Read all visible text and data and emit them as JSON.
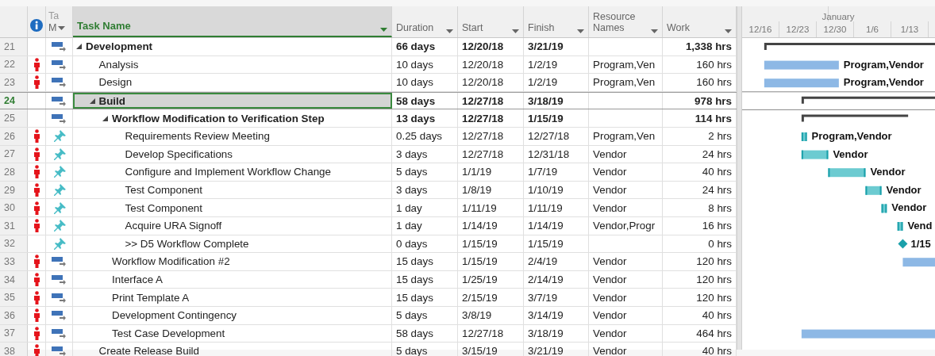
{
  "table": {
    "mode_header": [
      "Ta",
      "M"
    ],
    "columns": [
      {
        "label": "Task Name",
        "selected": true
      },
      {
        "label": "Duration",
        "selected": false
      },
      {
        "label": "Start",
        "selected": false
      },
      {
        "label": "Finish",
        "selected": false
      },
      {
        "label": "Resource Names",
        "selected": false
      },
      {
        "label": "Work",
        "selected": false
      }
    ],
    "tasks": [
      {
        "id": "21",
        "name": "Development",
        "kind": "summary",
        "manually_scheduled": false,
        "resource_alert": false,
        "selected": false,
        "duration": "66 days",
        "start": "12/20/18",
        "finish": "3/21/19",
        "work": "1,338 hrs",
        "children": [
          {
            "id": "22",
            "name": "Analysis",
            "kind": "task",
            "manually_scheduled": false,
            "resource_alert": true,
            "selected": false,
            "duration": "10 days",
            "start": "12/20/18",
            "finish": "1/2/19",
            "resources": "Program,Ven",
            "work": "160 hrs",
            "bar_label": "Program,Vendor"
          },
          {
            "id": "23",
            "name": "Design",
            "kind": "task",
            "manually_scheduled": false,
            "resource_alert": true,
            "selected": false,
            "duration": "10 days",
            "start": "12/20/18",
            "finish": "1/2/19",
            "resources": "Program,Ven",
            "work": "160 hrs",
            "bar_label": "Program,Vendor"
          },
          {
            "id": "24",
            "name": "Build",
            "kind": "summary",
            "manually_scheduled": false,
            "resource_alert": false,
            "selected": true,
            "duration": "58 days",
            "start": "12/27/18",
            "finish": "3/18/19",
            "work": "978 hrs",
            "children": [
              {
                "id": "25",
                "name": "Workflow Modification to Verification Step",
                "kind": "summary",
                "manually_scheduled": false,
                "resource_alert": false,
                "selected": false,
                "duration": "13 days",
                "start": "12/27/18",
                "finish": "1/15/19",
                "work": "114 hrs",
                "children": [
                  {
                    "id": "26",
                    "name": "Requirements Review Meeting",
                    "kind": "task",
                    "manually_scheduled": true,
                    "resource_alert": true,
                    "selected": false,
                    "duration": "0.25 days",
                    "start": "12/27/18",
                    "finish": "12/27/18",
                    "resources": "Program,Ven",
                    "work": "2 hrs",
                    "bar_label": "Program,Vendor"
                  },
                  {
                    "id": "27",
                    "name": "Develop Specifications",
                    "kind": "task",
                    "manually_scheduled": true,
                    "resource_alert": true,
                    "selected": false,
                    "duration": "3 days",
                    "start": "12/27/18",
                    "finish": "12/31/18",
                    "resources": "Vendor",
                    "work": "24 hrs",
                    "bar_label": "Vendor"
                  },
                  {
                    "id": "28",
                    "name": "Configure and Implement Workflow Change",
                    "kind": "task",
                    "manually_scheduled": true,
                    "resource_alert": true,
                    "selected": false,
                    "duration": "5 days",
                    "start": "1/1/19",
                    "finish": "1/7/19",
                    "resources": "Vendor",
                    "work": "40 hrs",
                    "bar_label": "Vendor"
                  },
                  {
                    "id": "29",
                    "name": "Test Component",
                    "kind": "task",
                    "manually_scheduled": true,
                    "resource_alert": true,
                    "selected": false,
                    "duration": "3 days",
                    "start": "1/8/19",
                    "finish": "1/10/19",
                    "resources": "Vendor",
                    "work": "24 hrs",
                    "bar_label": "Vendor"
                  },
                  {
                    "id": "30",
                    "name": "Test Component",
                    "kind": "task",
                    "manually_scheduled": true,
                    "resource_alert": true,
                    "selected": false,
                    "duration": "1 day",
                    "start": "1/11/19",
                    "finish": "1/11/19",
                    "resources": "Vendor",
                    "work": "8 hrs",
                    "bar_label": "Vendor"
                  },
                  {
                    "id": "31",
                    "name": "Acquire URA Signoff",
                    "kind": "task",
                    "manually_scheduled": true,
                    "resource_alert": true,
                    "selected": false,
                    "duration": "1 day",
                    "start": "1/14/19",
                    "finish": "1/14/19",
                    "resources": "Vendor,Progr",
                    "work": "16 hrs",
                    "bar_label": "Vend"
                  },
                  {
                    "id": "32",
                    "name": ">> D5 Workflow Complete",
                    "kind": "milestone",
                    "manually_scheduled": true,
                    "resource_alert": false,
                    "selected": false,
                    "duration": "0 days",
                    "start": "1/15/19",
                    "finish": "1/15/19",
                    "work": "0 hrs",
                    "bar_label": "1/15"
                  }
                ]
              },
              {
                "id": "33",
                "name": "Workflow Modification #2",
                "kind": "task",
                "manually_scheduled": false,
                "resource_alert": true,
                "selected": false,
                "duration": "15 days",
                "start": "1/15/19",
                "finish": "2/4/19",
                "resources": "Vendor",
                "work": "120 hrs"
              },
              {
                "id": "34",
                "name": "Interface A",
                "kind": "task",
                "manually_scheduled": false,
                "resource_alert": true,
                "selected": false,
                "duration": "15 days",
                "start": "1/25/19",
                "finish": "2/14/19",
                "resources": "Vendor",
                "work": "120 hrs"
              },
              {
                "id": "35",
                "name": "Print Template A",
                "kind": "task",
                "manually_scheduled": false,
                "resource_alert": true,
                "selected": false,
                "duration": "15 days",
                "start": "2/15/19",
                "finish": "3/7/19",
                "resources": "Vendor",
                "work": "120 hrs"
              },
              {
                "id": "36",
                "name": "Development Contingency",
                "kind": "task",
                "manually_scheduled": false,
                "resource_alert": true,
                "selected": false,
                "duration": "5 days",
                "start": "3/8/19",
                "finish": "3/14/19",
                "resources": "Vendor",
                "work": "40 hrs"
              },
              {
                "id": "37",
                "name": "Test Case Development",
                "kind": "task",
                "manually_scheduled": false,
                "resource_alert": true,
                "selected": false,
                "duration": "58 days",
                "start": "12/27/18",
                "finish": "3/18/19",
                "resources": "Vendor",
                "work": "464 hrs"
              }
            ]
          },
          {
            "id": "38",
            "name": "Create Release Build",
            "kind": "task",
            "manually_scheduled": false,
            "resource_alert": true,
            "selected": false,
            "duration": "5 days",
            "start": "3/15/19",
            "finish": "3/21/19",
            "resources": "Vendor",
            "work": "40 hrs"
          }
        ]
      }
    ]
  },
  "timescale": {
    "month": "January",
    "weeks": [
      "12/16",
      "12/23",
      "12/30",
      "1/6",
      "1/13"
    ]
  }
}
